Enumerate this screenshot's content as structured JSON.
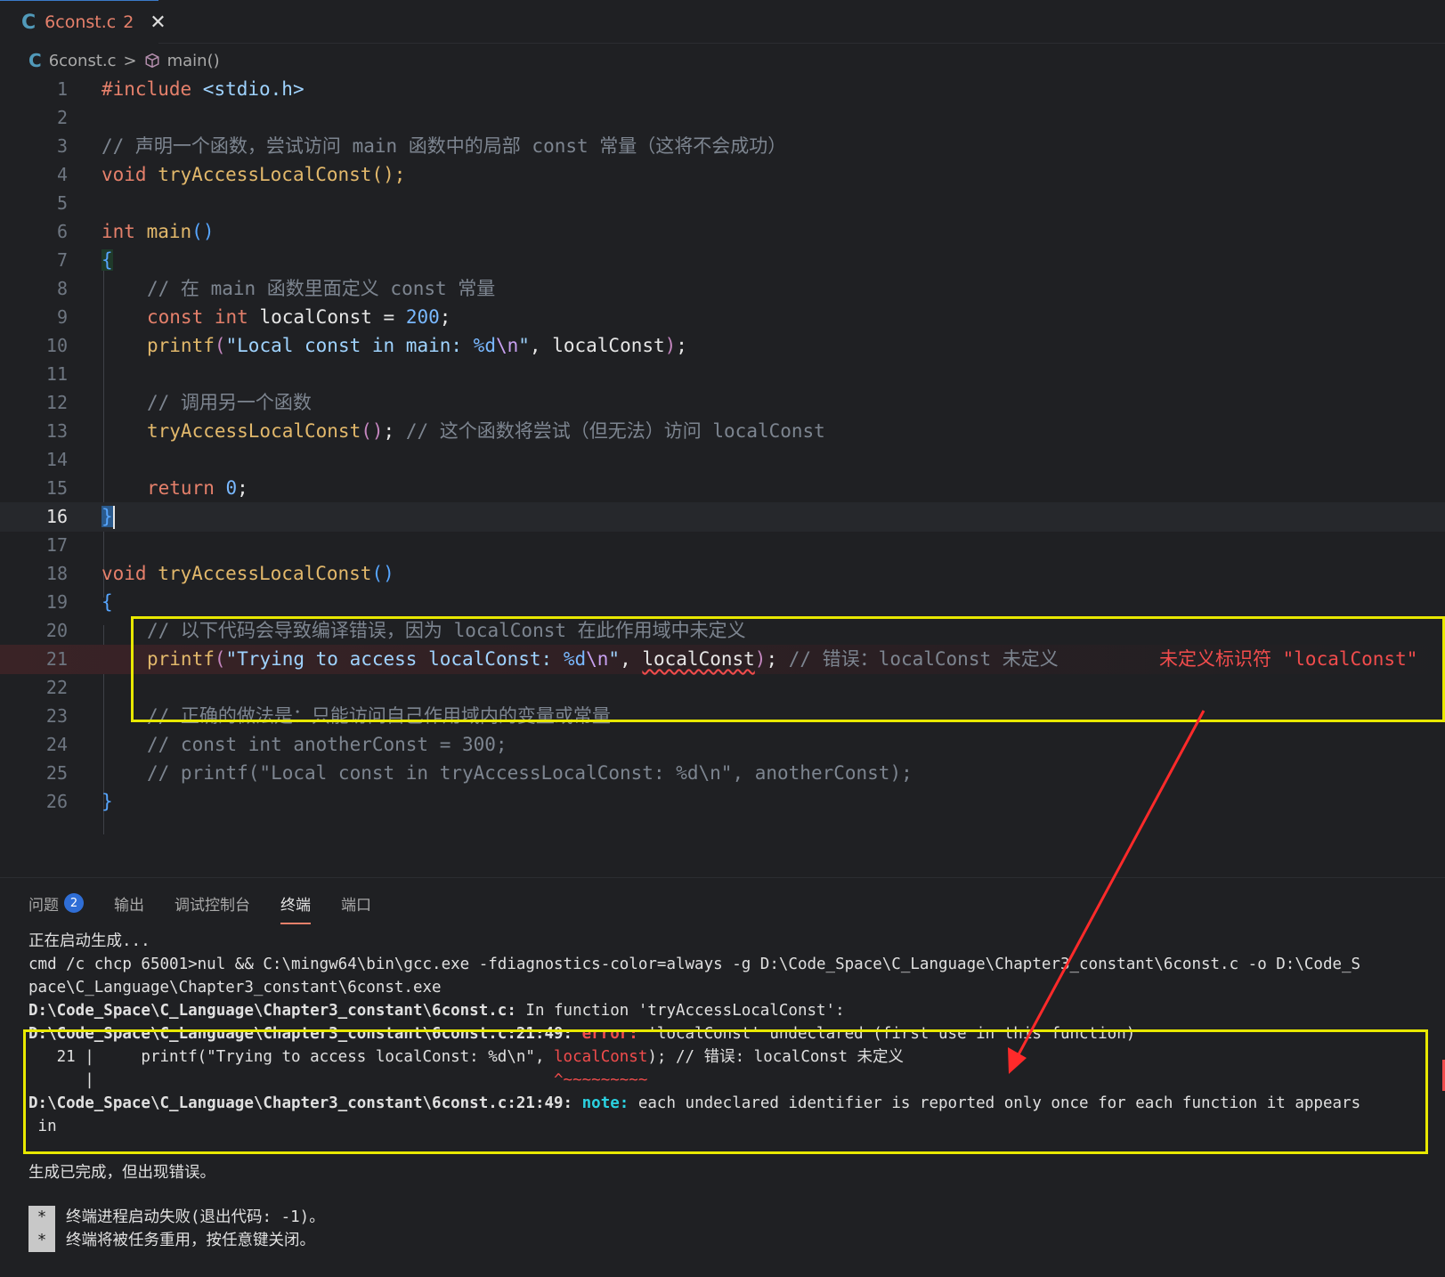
{
  "tab": {
    "icon": "C",
    "filename": "6const.c",
    "problem_count": "2",
    "close": "✕"
  },
  "breadcrumb": {
    "icon": "C",
    "file": "6const.c",
    "sep": ">",
    "symbol": "main()"
  },
  "editor": {
    "line_numbers": [
      "1",
      "2",
      "3",
      "4",
      "5",
      "6",
      "7",
      "8",
      "9",
      "10",
      "11",
      "12",
      "13",
      "14",
      "15",
      "16",
      "17",
      "18",
      "19",
      "20",
      "21",
      "22",
      "23",
      "24",
      "25",
      "26"
    ],
    "current_line": "16",
    "lines": {
      "l1": {
        "a": "#include ",
        "b": "<stdio.h>"
      },
      "l3": {
        "a": "// 声明一个函数，尝试访问 main 函数中的局部 const 常量（这将不会成功）"
      },
      "l4": {
        "a": "void",
        "b": " ",
        "c": "tryAccessLocalConst",
        "d": "();"
      },
      "l6": {
        "a": "int",
        "b": " ",
        "c": "main",
        "d": "()"
      },
      "l7": {
        "a": "{"
      },
      "l8": {
        "a": "// 在 main 函数里面定义 const 常量"
      },
      "l9": {
        "a": "const",
        "b": " ",
        "c": "int",
        "d": " localConst = ",
        "e": "200",
        "f": ";"
      },
      "l10": {
        "a": "printf",
        "b": "(",
        "c": "\"Local const in main: ",
        "d": "%d",
        "e": "\\n",
        "f": "\"",
        "g": ", localConst",
        "h": ")",
        "i": ";"
      },
      "l12": {
        "a": "// 调用另一个函数"
      },
      "l13": {
        "a": "tryAccessLocalConst",
        "b": "()",
        "c": "; ",
        "d": "// 这个函数将尝试（但无法）访问 localConst"
      },
      "l15": {
        "a": "return",
        "b": " ",
        "c": "0",
        "d": ";"
      },
      "l16": {
        "a": "}"
      },
      "l18": {
        "a": "void",
        "b": " ",
        "c": "tryAccessLocalConst",
        "d": "()"
      },
      "l19": {
        "a": "{"
      },
      "l20": {
        "a": "// 以下代码会导致编译错误，因为 localConst 在此作用域中未定义"
      },
      "l21": {
        "a": "printf",
        "b": "(",
        "c": "\"Trying to access localConst: ",
        "d": "%d",
        "e": "\\n",
        "f": "\"",
        "g": ", ",
        "h": "localConst",
        "i": ")",
        "j": "; ",
        "k": "// 错误：localConst 未定义",
        "err": "未定义标识符 \"localConst\""
      },
      "l23": {
        "a": "// 正确的做法是：只能访问自己作用域内的变量或常量"
      },
      "l24": {
        "a": "// const int anotherConst = 300;"
      },
      "l25": {
        "a": "// printf(\"Local const in tryAccessLocalConst: %d\\n\", anotherConst);"
      },
      "l26": {
        "a": "}"
      }
    }
  },
  "panel": {
    "tabs": [
      {
        "label": "问题",
        "badge": "2"
      },
      {
        "label": "输出"
      },
      {
        "label": "调试控制台"
      },
      {
        "label": "终端"
      },
      {
        "label": "端口"
      }
    ],
    "active_tab": "终端",
    "terminal": {
      "t1": "正在启动生成...",
      "t2": "cmd /c chcp 65001>nul && C:\\mingw64\\bin\\gcc.exe -fdiagnostics-color=always -g D:\\Code_Space\\C_Language\\Chapter3_constant\\6const.c -o D:\\Code_S",
      "t3": "pace\\C_Language\\Chapter3_constant\\6const.exe",
      "t4a": "D:\\Code_Space\\C_Language\\Chapter3_constant\\6const.c:",
      "t4b": " In function 'tryAccessLocalConst':",
      "t5a": "D:\\Code_Space\\C_Language\\Chapter3_constant\\6const.c:21:49:",
      "t5b": " error:",
      "t5c": " 'localConst' undeclared (first use in this function)",
      "t6a": "   21 |     printf(\"Trying to access localConst: %d\\n\", ",
      "t6b": "localConst",
      "t6c": "); // 错误: localConst 未定义",
      "t7a": "      |                                                 ",
      "t7b": "^~~~~~~~~~",
      "t8a": "D:\\Code_Space\\C_Language\\Chapter3_constant\\6const.c:21:49:",
      "t8b": " note:",
      "t8c": " each undeclared identifier is reported only once for each function it appears",
      "t9": " in",
      "t10": "生成已完成，但出现错误。",
      "t11": "终端进程启动失败(退出代码: -1)。",
      "t12": "终端将被任务重用，按任意键关闭。",
      "star": "*"
    }
  },
  "colors": {
    "highlight": "#e8e800",
    "arrow": "#ff2a2a",
    "error": "#f14c4c",
    "accent": "#3b7ac9"
  }
}
